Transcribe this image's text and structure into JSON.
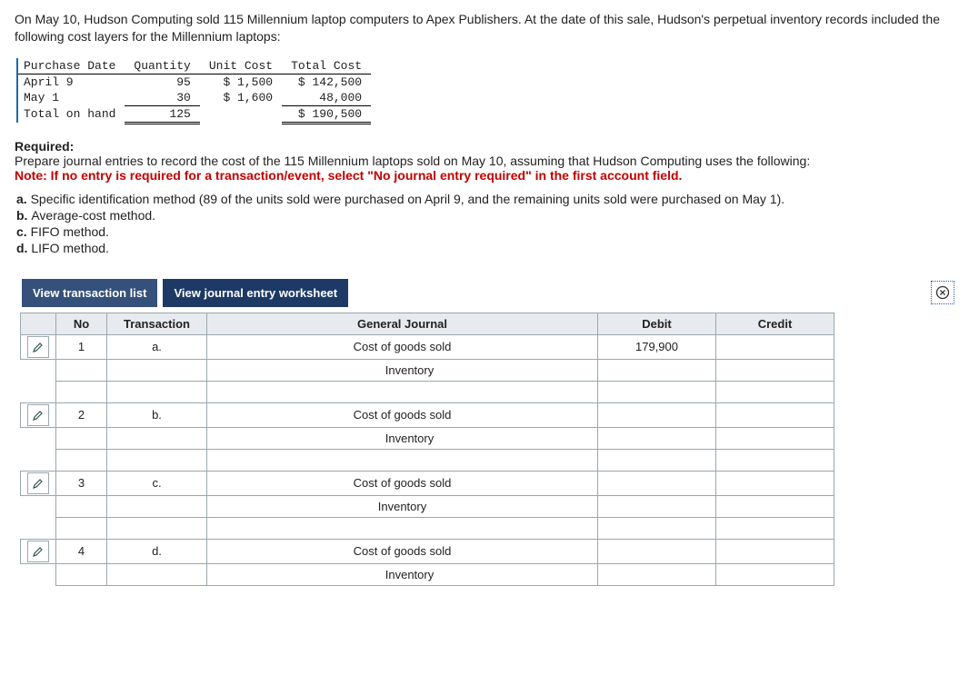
{
  "intro": "On May 10, Hudson Computing sold 115 Millennium laptop computers to Apex Publishers. At the date of this sale, Hudson's perpetual inventory records included the following cost layers for the Millennium laptops:",
  "cost_table": {
    "headers": {
      "c1": "Purchase Date",
      "c2": "Quantity",
      "c3": "Unit Cost",
      "c4": "Total Cost"
    },
    "rows": [
      {
        "date": "April 9",
        "qty": "95",
        "unit": "$ 1,500",
        "total": "$ 142,500"
      },
      {
        "date": "May 1",
        "qty": "30",
        "unit": "$ 1,600",
        "total": "48,000"
      }
    ],
    "total": {
      "label": "Total on hand",
      "qty": "125",
      "total": "$ 190,500"
    }
  },
  "required": {
    "title": "Required:",
    "body": "Prepare journal entries to record the cost of the 115 Millennium laptops sold on May 10, assuming that Hudson Computing uses the following:",
    "note": "Note: If no entry is required for a transaction/event, select \"No journal entry required\" in the first account field.",
    "items": {
      "a": "Specific identification method (89 of the units sold were purchased on April 9, and the remaining units sold were purchased on May 1).",
      "b": "Average-cost method.",
      "c": "FIFO method.",
      "d": "LIFO method."
    }
  },
  "tabs": {
    "list": "View transaction list",
    "worksheet": "View journal entry worksheet"
  },
  "journal": {
    "headers": {
      "no": "No",
      "txn": "Transaction",
      "gj": "General Journal",
      "debit": "Debit",
      "credit": "Credit"
    },
    "groups": [
      {
        "no": "1",
        "txn": "a.",
        "lines": [
          {
            "account": "Cost of goods sold",
            "indent": false,
            "debit": "179,900",
            "credit": ""
          },
          {
            "account": "Inventory",
            "indent": true,
            "debit": "",
            "credit": ""
          }
        ]
      },
      {
        "no": "2",
        "txn": "b.",
        "lines": [
          {
            "account": "Cost of goods sold",
            "indent": false,
            "debit": "",
            "credit": ""
          },
          {
            "account": "Inventory",
            "indent": true,
            "debit": "",
            "credit": ""
          }
        ]
      },
      {
        "no": "3",
        "txn": "c.",
        "lines": [
          {
            "account": "Cost of goods sold",
            "indent": false,
            "debit": "",
            "credit": ""
          },
          {
            "account": "Inventory",
            "indent": false,
            "debit": "",
            "credit": ""
          }
        ]
      },
      {
        "no": "4",
        "txn": "d.",
        "lines": [
          {
            "account": "Cost of goods sold",
            "indent": false,
            "debit": "",
            "credit": ""
          },
          {
            "account": "Inventory",
            "indent": true,
            "debit": "",
            "credit": ""
          }
        ]
      }
    ]
  }
}
